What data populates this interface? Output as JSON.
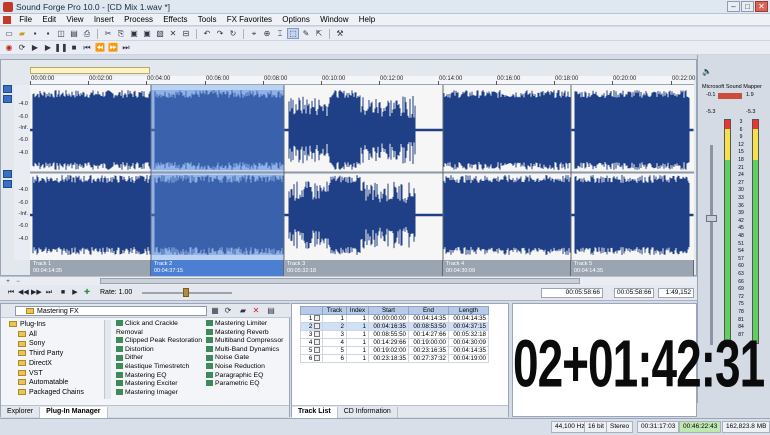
{
  "window": {
    "title": "Sound Forge Pro 10.0 - [CD Mix 1.wav *]",
    "min": "–",
    "max": "□",
    "close": "✕"
  },
  "menu": [
    "File",
    "Edit",
    "View",
    "Insert",
    "Process",
    "Effects",
    "Tools",
    "FX Favorites",
    "Options",
    "Window",
    "Help"
  ],
  "ruler": [
    "00:00:00",
    "00:02:00",
    "00:04:00",
    "00:06:00",
    "00:08:00",
    "00:10:00",
    "00:12:00",
    "00:14:00",
    "00:16:00",
    "00:18:00",
    "00:20:00",
    "00:22:00"
  ],
  "db_top": [
    "-4.0",
    "-6.0",
    "-Inf.",
    "-6.0",
    "-4.0"
  ],
  "db_bottom": [
    "-4.0",
    "-6.0",
    "-Inf.",
    "-6.0",
    "-4.0"
  ],
  "regions": [
    {
      "name": "Track 1",
      "time": "00:04:14:35"
    },
    {
      "name": "Track 2",
      "time": "00:04:37:15"
    },
    {
      "name": "Track 3",
      "time": "00:05:32:18"
    },
    {
      "name": "Track 4",
      "time": "00:04:30:09"
    },
    {
      "name": "Track 5",
      "time": "00:04:14:35"
    }
  ],
  "transport": {
    "rate_label": "Rate: 1.00",
    "time1": "00:05:58:66",
    "time2": "00:05:58:66",
    "ratio": "1:49,152"
  },
  "meters": {
    "device": "Microsoft Sound Mapper",
    "left_peak": "-0.1",
    "right_peak": "1.9",
    "l_val": "-5.3",
    "r_val": "-5.3",
    "scale": [
      "3",
      "6",
      "9",
      "12",
      "15",
      "18",
      "21",
      "24",
      "27",
      "30",
      "33",
      "36",
      "39",
      "42",
      "45",
      "48",
      "51",
      "54",
      "57",
      "60",
      "63",
      "66",
      "69",
      "72",
      "75",
      "78",
      "81",
      "84",
      "87"
    ]
  },
  "plugin_panel": {
    "select_value": "Mastering FX",
    "tree": [
      "Plug-Ins",
      "All",
      "Sony",
      "Third Party",
      "DirectX",
      "VST",
      "Automatable",
      "Packaged Chains"
    ],
    "fx_left": [
      "Click and Crackle Removal",
      "Clipped Peak Restoration",
      "Distortion",
      "Dither",
      "élastique Timestretch",
      "Mastering EQ",
      "Mastering Exciter",
      "Mastering Imager"
    ],
    "fx_right": [
      "Mastering Limiter",
      "Mastering Reverb",
      "Multiband Compressor",
      "Multi-Band Dynamics",
      "Noise Gate",
      "Noise Reduction",
      "Paragraphic EQ",
      "Parametric EQ"
    ],
    "tabs": [
      "Explorer",
      "Plug-In Manager"
    ]
  },
  "track_list": {
    "headers": [
      "Track",
      "Index",
      "Start",
      "End",
      "Length"
    ],
    "rows": [
      {
        "n": "1",
        "track": "1",
        "index": "1",
        "start": "00:00:00:00",
        "end": "00:04:14:35",
        "length": "00:04:14:35"
      },
      {
        "n": "2",
        "track": "2",
        "index": "1",
        "start": "00:04:16:35",
        "end": "00:08:53:50",
        "length": "00:04:37:15"
      },
      {
        "n": "3",
        "track": "3",
        "index": "1",
        "start": "00:08:55:50",
        "end": "00:14:27:66",
        "length": "00:05:32:18"
      },
      {
        "n": "4",
        "track": "4",
        "index": "1",
        "start": "00:14:29:66",
        "end": "00:19:00:00",
        "length": "00:04:30:09"
      },
      {
        "n": "5",
        "track": "5",
        "index": "1",
        "start": "00:19:02:00",
        "end": "00:23:16:35",
        "length": "00:04:14:35"
      },
      {
        "n": "6",
        "track": "6",
        "index": "1",
        "start": "00:23:18:35",
        "end": "00:27:37:32",
        "length": "00:04:19:00"
      }
    ],
    "tabs": [
      "Track List",
      "CD Information"
    ]
  },
  "time_display": "02+01:42:31",
  "status": {
    "rate": "44,100 Hz",
    "bits": "16 bit",
    "channels": "Stereo",
    "length": "00:31:17:03",
    "free": "00:46:22:43",
    "space": "162,823.8 MB"
  }
}
